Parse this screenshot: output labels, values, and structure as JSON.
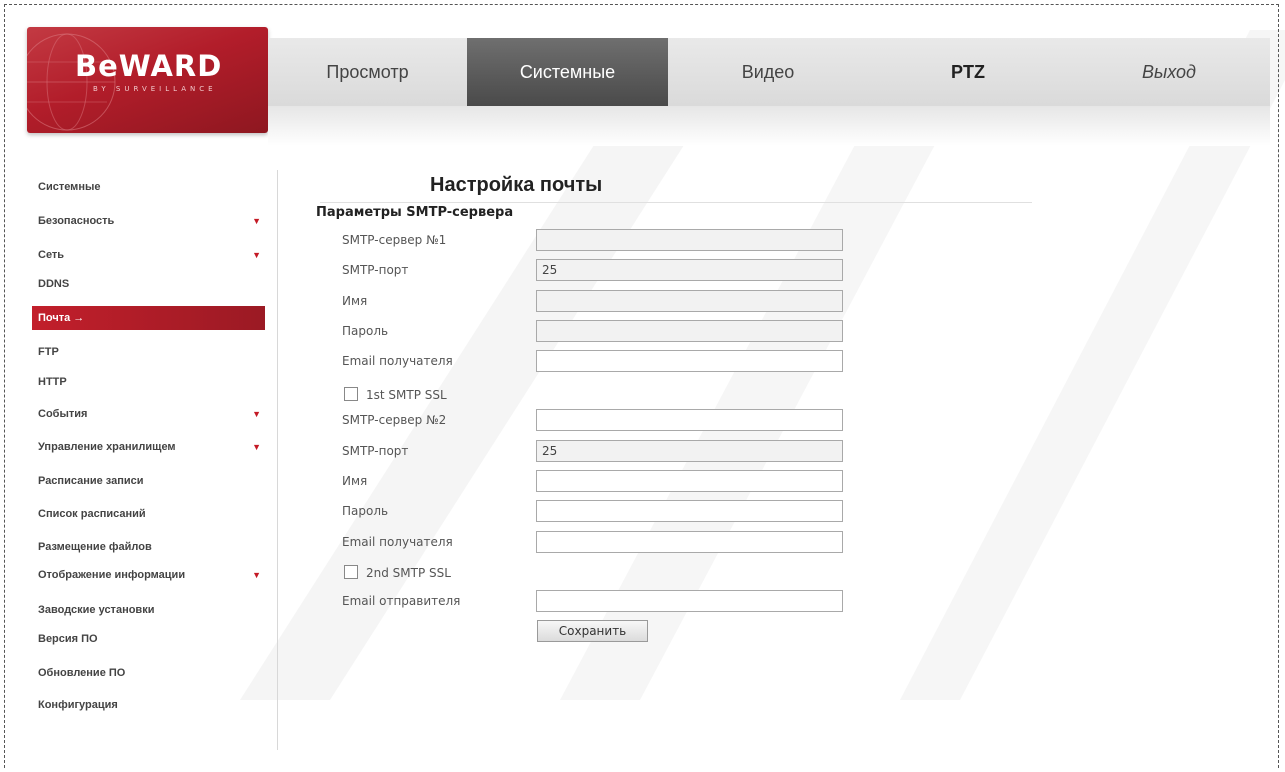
{
  "logo": {
    "text": "BeWARD",
    "subtext": "BY SURVEILLANCE"
  },
  "nav": {
    "items": [
      {
        "label": "Просмотр"
      },
      {
        "label": "Системные"
      },
      {
        "label": "Видео"
      },
      {
        "label": "PTZ"
      },
      {
        "label": "Выход"
      }
    ],
    "active": "Системные"
  },
  "sidebar": {
    "items": [
      {
        "label": "Системные",
        "has_submenu": false
      },
      {
        "label": "Безопасность",
        "has_submenu": true
      },
      {
        "label": "Сеть",
        "has_submenu": true
      },
      {
        "label": "DDNS",
        "has_submenu": false
      },
      {
        "label": "Почта →",
        "has_submenu": false,
        "active": true
      },
      {
        "label": "FTP",
        "has_submenu": false
      },
      {
        "label": "HTTP",
        "has_submenu": false
      },
      {
        "label": "События",
        "has_submenu": true
      },
      {
        "label": "Управление хранилищем",
        "has_submenu": true
      },
      {
        "label": "Расписание записи",
        "has_submenu": false
      },
      {
        "label": "Список расписаний",
        "has_submenu": false
      },
      {
        "label": "Размещение файлов",
        "has_submenu": false
      },
      {
        "label": "Отображение информации",
        "has_submenu": true
      },
      {
        "label": "Заводские установки",
        "has_submenu": false
      },
      {
        "label": "Версия ПО",
        "has_submenu": false
      },
      {
        "label": "Обновление ПО",
        "has_submenu": false
      },
      {
        "label": "Конфигурация",
        "has_submenu": false
      }
    ],
    "submenu_marker": "▼"
  },
  "page": {
    "title": "Настройка почты",
    "section": "Параметры SMTP-сервера"
  },
  "form": {
    "smtp1": {
      "server_label": "SMTP-сервер №1",
      "server_value": "",
      "port_label": "SMTP-порт",
      "port_value": "25",
      "name_label": "Имя",
      "name_value": "",
      "password_label": "Пароль",
      "password_value": "",
      "recipient_label": "Email получателя",
      "recipient_value": "",
      "ssl_label": "1st SMTP SSL",
      "ssl_checked": false
    },
    "smtp2": {
      "server_label": "SMTP-сервер №2",
      "server_value": "",
      "port_label": "SMTP-порт",
      "port_value": "25",
      "name_label": "Имя",
      "name_value": "",
      "password_label": "Пароль",
      "password_value": "",
      "recipient_label": "Email получателя",
      "recipient_value": "",
      "ssl_label": "2nd SMTP SSL",
      "ssl_checked": false
    },
    "sender_label": "Email отправителя",
    "sender_value": "",
    "save_label": "Сохранить"
  },
  "colors": {
    "brand_red": "#b21d2a",
    "active_tab": "#4a4a4a",
    "submenu_arrow": "#c41a25",
    "watermark": "#e9e9e9"
  }
}
